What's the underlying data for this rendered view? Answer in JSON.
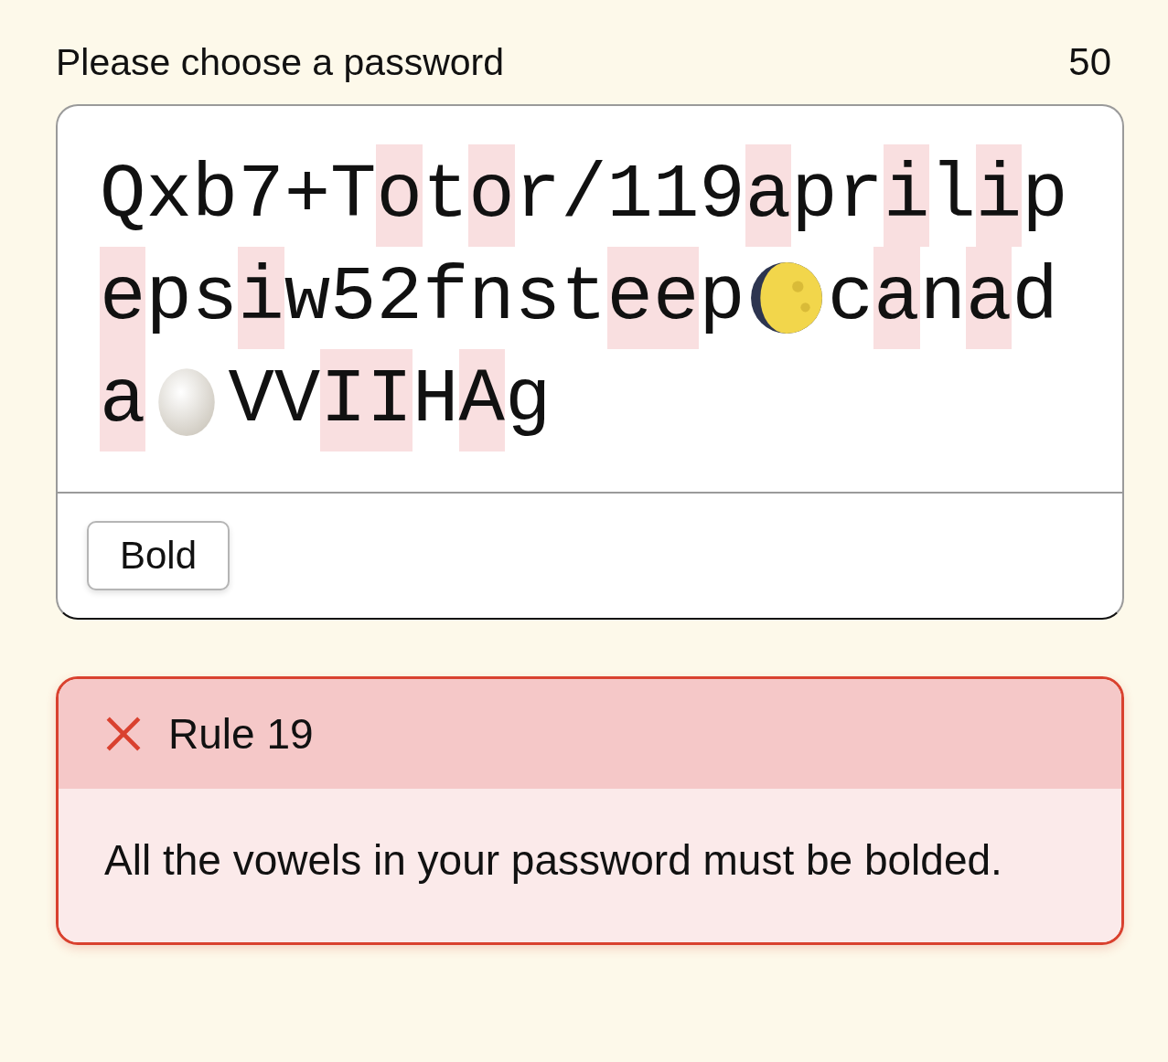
{
  "header": {
    "label": "Please choose a password",
    "count": "50"
  },
  "password": {
    "lines": [
      [
        {
          "kind": "text",
          "text": "Qxb7+T",
          "highlighted": false
        },
        {
          "kind": "text",
          "text": "o",
          "highlighted": true
        },
        {
          "kind": "text",
          "text": "t",
          "highlighted": false
        },
        {
          "kind": "text",
          "text": "o",
          "highlighted": true
        },
        {
          "kind": "text",
          "text": "r/119",
          "highlighted": false
        },
        {
          "kind": "text",
          "text": "a",
          "highlighted": true
        },
        {
          "kind": "text",
          "text": "pr",
          "highlighted": false
        },
        {
          "kind": "text",
          "text": "i",
          "highlighted": true
        },
        {
          "kind": "text",
          "text": "l",
          "highlighted": false
        },
        {
          "kind": "text",
          "text": "i",
          "highlighted": true
        },
        {
          "kind": "text",
          "text": "p",
          "highlighted": false
        }
      ],
      [
        {
          "kind": "text",
          "text": "e",
          "highlighted": true
        },
        {
          "kind": "text",
          "text": "ps",
          "highlighted": false
        },
        {
          "kind": "text",
          "text": "i",
          "highlighted": true
        },
        {
          "kind": "text",
          "text": "w52fnst",
          "highlighted": false
        },
        {
          "kind": "text",
          "text": "ee",
          "highlighted": true
        },
        {
          "kind": "text",
          "text": "p",
          "highlighted": false
        },
        {
          "kind": "moon"
        },
        {
          "kind": "text",
          "text": "c",
          "highlighted": false
        },
        {
          "kind": "text",
          "text": "a",
          "highlighted": true
        },
        {
          "kind": "text",
          "text": "n",
          "highlighted": false
        },
        {
          "kind": "text",
          "text": "a",
          "highlighted": true
        },
        {
          "kind": "text",
          "text": "d",
          "highlighted": false
        }
      ],
      [
        {
          "kind": "text",
          "text": "a",
          "highlighted": true
        },
        {
          "kind": "egg"
        },
        {
          "kind": "text",
          "text": "VV",
          "highlighted": false
        },
        {
          "kind": "text",
          "text": "II",
          "highlighted": true
        },
        {
          "kind": "text",
          "text": "H",
          "highlighted": false
        },
        {
          "kind": "text",
          "text": "A",
          "highlighted": true
        },
        {
          "kind": "text",
          "text": "g",
          "highlighted": false
        }
      ]
    ]
  },
  "toolbar": {
    "buttons": [
      "Bold"
    ]
  },
  "rule": {
    "title": "Rule 19",
    "passed": false,
    "text": "All the vowels in your password must be bolded."
  }
}
